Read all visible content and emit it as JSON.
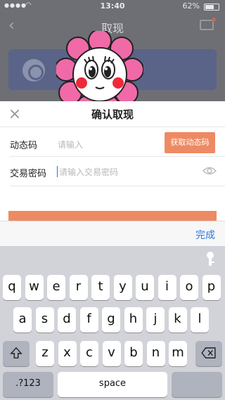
{
  "status_bar": {
    "time": "13:40",
    "battery": "62%"
  },
  "nav": {
    "title": "取现"
  },
  "dialog": {
    "title": "确认取现",
    "code_label": "动态码",
    "code_placeholder": "请输入",
    "get_code_button": "获取动态码",
    "password_label": "交易密码",
    "password_placeholder": "请输入交易密码"
  },
  "keyboard": {
    "done_label": "完成",
    "row1": [
      "q",
      "w",
      "e",
      "r",
      "t",
      "y",
      "u",
      "i",
      "o",
      "p"
    ],
    "row2": [
      "a",
      "s",
      "d",
      "f",
      "g",
      "h",
      "j",
      "k",
      "l"
    ],
    "row3": [
      "z",
      "x",
      "c",
      "v",
      "b",
      "n",
      "m"
    ],
    "numbers_label": ".?123",
    "space_label": "space"
  },
  "colors": {
    "accent_orange": "#ee8a63",
    "done_blue": "#2f78d8",
    "sticker_petal": "#f06aa8"
  },
  "icons": [
    "back-arrow-icon",
    "message-icon",
    "bank-logo-icon",
    "close-icon",
    "eye-icon",
    "key-icon",
    "shift-icon",
    "delete-icon"
  ]
}
